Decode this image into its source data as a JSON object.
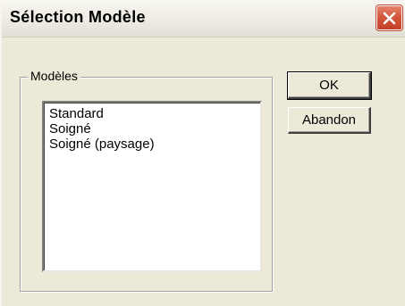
{
  "window": {
    "title": "Sélection Modèle",
    "close_icon": "close-icon"
  },
  "models_group": {
    "label": "Modèles",
    "items": [
      {
        "label": "Standard"
      },
      {
        "label": "Soigné"
      },
      {
        "label": "Soigné (paysage)"
      }
    ]
  },
  "buttons": {
    "ok_label": "OK",
    "cancel_label": "Abandon"
  },
  "colors": {
    "dialog_bg": "#ece9d8",
    "close_button": "#d4583e"
  }
}
